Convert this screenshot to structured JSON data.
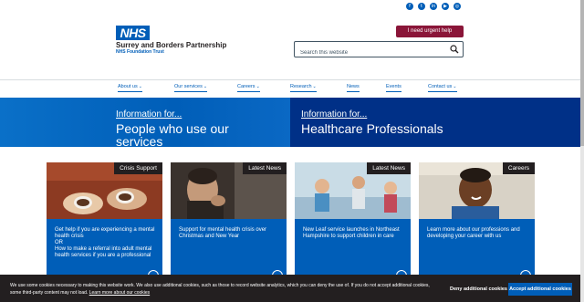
{
  "social": {
    "icons": [
      "facebook-icon",
      "twitter-icon",
      "linkedin-icon",
      "youtube-icon",
      "instagram-icon"
    ]
  },
  "header": {
    "logo_nhs": "NHS",
    "org_name": "Surrey and Borders Partnership",
    "org_sub": "NHS Foundation Trust",
    "urgent_help": "I need urgent help",
    "search_placeholder": "Search this website"
  },
  "nav": {
    "items": [
      {
        "label": "About us",
        "dropdown": true
      },
      {
        "label": "Our services",
        "dropdown": true
      },
      {
        "label": "Careers",
        "dropdown": true
      },
      {
        "label": "Research",
        "dropdown": true
      },
      {
        "label": "News",
        "dropdown": false
      },
      {
        "label": "Events",
        "dropdown": false
      },
      {
        "label": "Contact us",
        "dropdown": true
      }
    ]
  },
  "hero": {
    "left": {
      "small": "Information for...",
      "big": "People who use our services"
    },
    "right": {
      "small": "Information for...",
      "big": "Healthcare Professionals"
    }
  },
  "cards": [
    {
      "tag": "Crisis Support",
      "text": "Get help if you are experiencing a mental health crisis\nOR\nHow to make a referral into adult mental health services if you are a professional"
    },
    {
      "tag": "Latest News",
      "text": "Support for mental health crisis over Christmas and New Year"
    },
    {
      "tag": "Latest News",
      "text": "New Leaf service launches in Northeast Hampshire to support children in care"
    },
    {
      "tag": "Careers",
      "text": "Learn more about our professions and developing your career with us"
    }
  ],
  "cookie": {
    "message": "We use some cookies necessary to making this website work. We also use additional cookies, such as those to record website analytics, which you can deny the use of. If you do not accept additional cookies, some third-party content may not load.",
    "link": "Learn more about our cookies",
    "deny": "Deny additional cookies",
    "accept": "Accept additional cookies"
  },
  "colors": {
    "nhs_blue": "#005eb8",
    "dark_blue": "#003087",
    "urgent": "#8a1538",
    "cookie_bg": "#231f20"
  }
}
